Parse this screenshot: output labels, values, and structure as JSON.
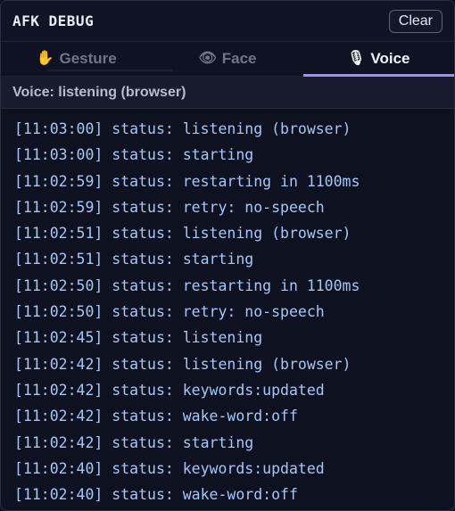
{
  "header": {
    "title": "AFK DEBUG",
    "clear_label": "Clear"
  },
  "tabs": [
    {
      "label": "Gesture",
      "icon": "raised-hand-icon",
      "glyph": "✋",
      "active": false
    },
    {
      "label": "Face",
      "icon": "eye-icon",
      "glyph": "👁",
      "active": false
    },
    {
      "label": "Voice",
      "icon": "microphone-icon",
      "glyph": "🎙",
      "active": true
    }
  ],
  "status": "Voice: listening (browser)",
  "log": [
    "[11:03:00] status: listening (browser)",
    "[11:03:00] status: starting",
    "[11:02:59] status: restarting in 1100ms",
    "[11:02:59] status: retry: no-speech",
    "[11:02:51] status: listening (browser)",
    "[11:02:51] status: starting",
    "[11:02:50] status: restarting in 1100ms",
    "[11:02:50] status: retry: no-speech",
    "[11:02:45] status: listening",
    "[11:02:42] status: listening (browser)",
    "[11:02:42] status: keywords:updated",
    "[11:02:42] status: wake-word:off",
    "[11:02:42] status: starting",
    "[11:02:40] status: keywords:updated",
    "[11:02:40] status: wake-word:off"
  ],
  "colors": {
    "accent": "#a58cf5",
    "background": "#0d1120",
    "log_text": "#a7c7f7"
  }
}
